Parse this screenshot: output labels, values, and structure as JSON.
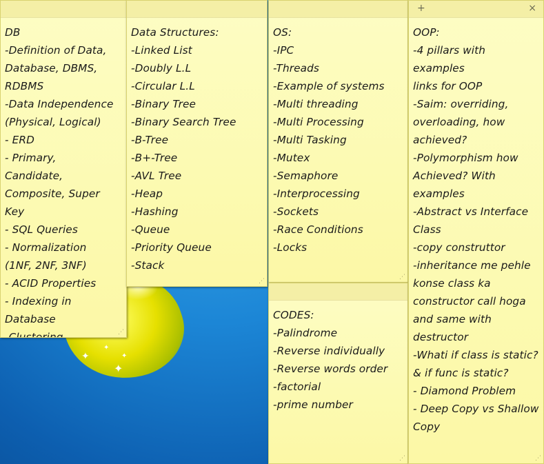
{
  "notes": {
    "db": {
      "lines": [
        "DB",
        "-Definition of Data,",
        "Database, DBMS,",
        "RDBMS",
        "-Data Independence",
        "(Physical, Logical)",
        "- ERD",
        "- Primary,",
        "Candidate,",
        "Composite, Super Key",
        "- SQL Queries",
        "- Normalization",
        "(1NF, 2NF, 3NF)",
        "- ACID Properties",
        "- Indexing in",
        "Database",
        "-Clustering"
      ]
    },
    "ds": {
      "lines": [
        "Data Structures:",
        "-Linked List",
        "-Doubly L.L",
        "-Circular L.L",
        "-Binary Tree",
        "-Binary Search Tree",
        "-B-Tree",
        "-B+-Tree",
        "-AVL Tree",
        "-Heap",
        "-Hashing",
        "-Queue",
        "-Priority Queue",
        "-Stack"
      ]
    },
    "os": {
      "lines": [
        "OS:",
        "-IPC",
        "-Threads",
        "-Example of systems",
        "-Multi threading",
        "-Multi Processing",
        "-Multi Tasking",
        "-Mutex",
        "-Semaphore",
        "-Interprocessing",
        "-Sockets",
        "-Race Conditions",
        "-Locks"
      ]
    },
    "codes": {
      "lines": [
        "CODES:",
        "-Palindrome",
        "-Reverse individually",
        "-Reverse words order",
        "-factorial",
        "-prime number"
      ]
    },
    "oop": {
      "add_label": "+",
      "close_label": "×",
      "lines": [
        "OOP:",
        "-4 pillars with",
        "examples",
        "links for OOP",
        "-Saim: overriding,",
        "overloading, how",
        "achieved?",
        "-Polymorphism how",
        "Achieved? With",
        "examples",
        "-Abstract vs Interface",
        "Class",
        "-copy construttor",
        "-inheritance me pehle",
        "konse class ka",
        "constructor call hoga",
        "and same with",
        "destructor",
        "-Whati if class is static?",
        "& if func is static?",
        "- Diamond Problem",
        "- Deep Copy vs Shallow",
        "Copy"
      ]
    }
  },
  "icons": {
    "resize_grip": "resize-grip-icon",
    "sparkle": "sparkle-icon"
  },
  "colors": {
    "note_bg": "#fcf8a6",
    "note_border": "#d8d270",
    "desktop_blue": "#1c86d6"
  }
}
